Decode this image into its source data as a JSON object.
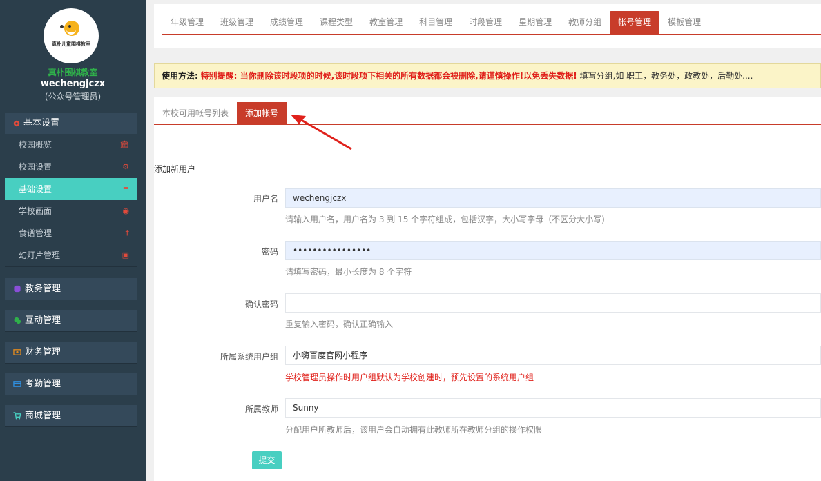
{
  "sidebar": {
    "logo_text": "真朴儿童围棋教室",
    "school_name": "真朴围棋教室",
    "username": "wechengjczx",
    "role": "(公众号管理员)",
    "basic_settings": {
      "title": "基本设置",
      "items": [
        {
          "label": "校园概览",
          "icon": "bank-icon"
        },
        {
          "label": "校园设置",
          "icon": "gear-icon"
        },
        {
          "label": "基础设置",
          "icon": "menu-icon"
        },
        {
          "label": "学校画面",
          "icon": "eye-icon"
        },
        {
          "label": "食谱管理",
          "icon": "cutlery-icon"
        },
        {
          "label": "幻灯片管理",
          "icon": "image-icon"
        }
      ]
    },
    "groups": [
      {
        "label": "教务管理",
        "icon": "database-icon",
        "color": "#8a4fd8"
      },
      {
        "label": "互动管理",
        "icon": "chat-icon",
        "color": "#2fb04a"
      },
      {
        "label": "财务管理",
        "icon": "money-icon",
        "color": "#e08a1e"
      },
      {
        "label": "考勤管理",
        "icon": "card-icon",
        "color": "#2f8fe0"
      },
      {
        "label": "商城管理",
        "icon": "cart-icon",
        "color": "#48cfc1"
      }
    ]
  },
  "top_tabs": [
    "年级管理",
    "班级管理",
    "成绩管理",
    "课程类型",
    "教室管理",
    "科目管理",
    "时段管理",
    "星期管理",
    "教师分组",
    "帐号管理",
    "模板管理"
  ],
  "notice": {
    "label": "使用方法:",
    "warning": "特别提醒: 当你删除该时段项的时候,该时段项下相关的所有数据都会被删除,请谨慎操作!以免丢失数据!",
    "text": " 填写分组,如 职工，教务处，政教处，后勤处...."
  },
  "sub_tabs": [
    "本校可用帐号列表",
    "添加帐号"
  ],
  "form": {
    "section_title": "添加新用户",
    "username": {
      "label": "用户名",
      "value": "wechengjczx",
      "help": "请输入用户名，用户名为 3 到 15 个字符组成，包括汉字，大小写字母（不区分大小写)"
    },
    "password": {
      "label": "密码",
      "value": "••••••••••••••••",
      "help": "请填写密码，最小长度为 8 个字符"
    },
    "confirm": {
      "label": "确认密码",
      "value": "",
      "help": "重复输入密码，确认正确输入"
    },
    "group": {
      "label": "所属系统用户组",
      "value": "小嗨百度官网小程序",
      "help": "学校管理员操作时用户组默认为学校创建时，预先设置的系统用户组"
    },
    "teacher": {
      "label": "所属教师",
      "value": "Sunny",
      "help": "分配用户所教师后，该用户会自动拥有此教师所在教师分组的操作权限"
    },
    "submit_label": "提交"
  },
  "colors": {
    "accent": "#c83c2a",
    "teal": "#48cfc1",
    "sidebar": "#2b3e4b"
  }
}
